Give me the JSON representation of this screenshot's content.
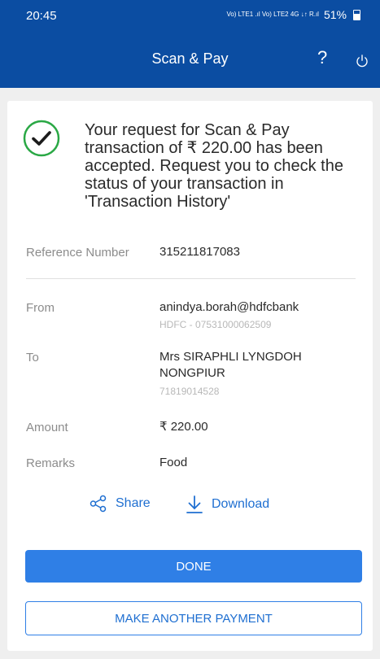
{
  "status_bar": {
    "time": "20:45",
    "signal_text": "Vo) LTE1 .ıl Vo) LTE2 4G ↓↑ R.ıl",
    "battery": "51%"
  },
  "app_bar": {
    "title": "Scan & Pay",
    "help_label": "?",
    "icons": [
      "help-icon",
      "power-icon"
    ]
  },
  "result": {
    "icon": "check-circle-icon",
    "message": "Your request for Scan & Pay transaction of ₹ 220.00 has been accepted. Request you to check the status of your transaction in 'Transaction History'"
  },
  "details": {
    "reference_label": "Reference Number",
    "reference_value": "315211817083",
    "from_label": "From",
    "from_value": "anindya.borah@hdfcbank",
    "from_sub": "HDFC - 07531000062509",
    "to_label": "To",
    "to_value": "Mrs SIRAPHLI LYNGDOH NONGPIUR",
    "to_sub": "71819014528",
    "amount_label": "Amount",
    "amount_value": "₹ 220.00",
    "remarks_label": "Remarks",
    "remarks_value": "Food"
  },
  "actions": {
    "share_label": "Share",
    "download_label": "Download"
  },
  "buttons": {
    "done": "DONE",
    "another": "MAKE ANOTHER PAYMENT"
  },
  "colors": {
    "brand": "#0b4da2",
    "accent": "#2f7fe6",
    "success": "#2aa845"
  }
}
